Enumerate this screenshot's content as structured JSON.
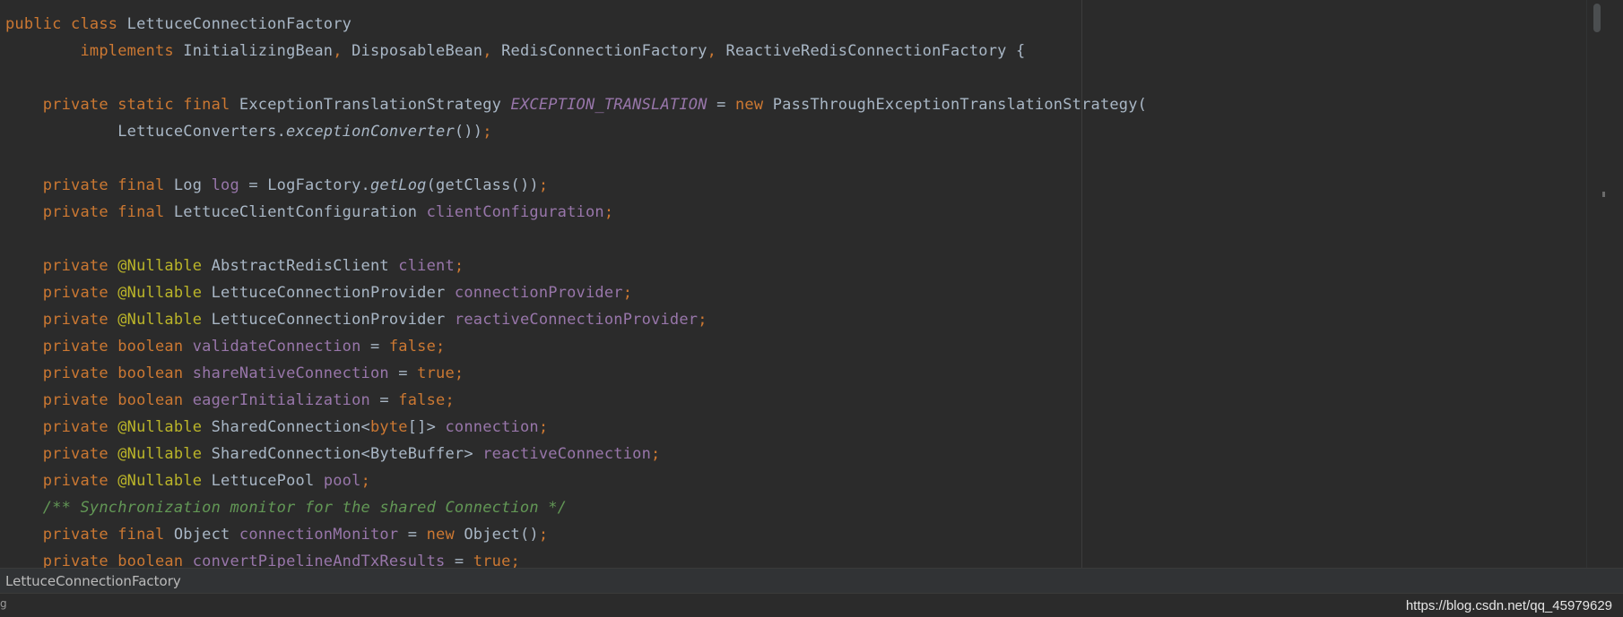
{
  "editor": {
    "lines": [
      [
        {
          "t": "public ",
          "c": "kw"
        },
        {
          "t": "class ",
          "c": "kw"
        },
        {
          "t": "LettuceConnectionFactory",
          "c": "id"
        }
      ],
      [
        {
          "t": "        ",
          "c": "id"
        },
        {
          "t": "implements ",
          "c": "kw"
        },
        {
          "t": "InitializingBean",
          "c": "id"
        },
        {
          "t": ", ",
          "c": "kw"
        },
        {
          "t": "DisposableBean",
          "c": "id"
        },
        {
          "t": ", ",
          "c": "kw"
        },
        {
          "t": "RedisConnectionFactory",
          "c": "id"
        },
        {
          "t": ", ",
          "c": "kw"
        },
        {
          "t": "ReactiveRedisConnectionFactory {",
          "c": "id"
        }
      ],
      [],
      [
        {
          "t": "    ",
          "c": "id"
        },
        {
          "t": "private static final ",
          "c": "kw"
        },
        {
          "t": "ExceptionTranslationStrategy ",
          "c": "id"
        },
        {
          "t": "EXCEPTION_TRANSLATION",
          "c": "sfld"
        },
        {
          "t": " = ",
          "c": "id"
        },
        {
          "t": "new ",
          "c": "kw"
        },
        {
          "t": "PassThroughExceptionTranslationStrategy(",
          "c": "id"
        }
      ],
      [
        {
          "t": "            LettuceConverters.",
          "c": "id"
        },
        {
          "t": "exceptionConverter",
          "c": "smeth"
        },
        {
          "t": "())",
          "c": "id"
        },
        {
          "t": ";",
          "c": "kw"
        }
      ],
      [],
      [
        {
          "t": "    ",
          "c": "id"
        },
        {
          "t": "private final ",
          "c": "kw"
        },
        {
          "t": "Log ",
          "c": "id"
        },
        {
          "t": "log",
          "c": "fld"
        },
        {
          "t": " = LogFactory.",
          "c": "id"
        },
        {
          "t": "getLog",
          "c": "smeth"
        },
        {
          "t": "(getClass())",
          "c": "id"
        },
        {
          "t": ";",
          "c": "kw"
        }
      ],
      [
        {
          "t": "    ",
          "c": "id"
        },
        {
          "t": "private final ",
          "c": "kw"
        },
        {
          "t": "LettuceClientConfiguration ",
          "c": "id"
        },
        {
          "t": "clientConfiguration",
          "c": "fld"
        },
        {
          "t": ";",
          "c": "kw"
        }
      ],
      [],
      [
        {
          "t": "    ",
          "c": "id"
        },
        {
          "t": "private ",
          "c": "kw"
        },
        {
          "t": "@Nullable ",
          "c": "ann"
        },
        {
          "t": "AbstractRedisClient ",
          "c": "id"
        },
        {
          "t": "client",
          "c": "fld"
        },
        {
          "t": ";",
          "c": "kw"
        }
      ],
      [
        {
          "t": "    ",
          "c": "id"
        },
        {
          "t": "private ",
          "c": "kw"
        },
        {
          "t": "@Nullable ",
          "c": "ann"
        },
        {
          "t": "LettuceConnectionProvider ",
          "c": "id"
        },
        {
          "t": "connectionProvider",
          "c": "fld"
        },
        {
          "t": ";",
          "c": "kw"
        }
      ],
      [
        {
          "t": "    ",
          "c": "id"
        },
        {
          "t": "private ",
          "c": "kw"
        },
        {
          "t": "@Nullable ",
          "c": "ann"
        },
        {
          "t": "LettuceConnectionProvider ",
          "c": "id"
        },
        {
          "t": "reactiveConnectionProvider",
          "c": "fld"
        },
        {
          "t": ";",
          "c": "kw"
        }
      ],
      [
        {
          "t": "    ",
          "c": "id"
        },
        {
          "t": "private boolean ",
          "c": "kw"
        },
        {
          "t": "validateConnection",
          "c": "fld"
        },
        {
          "t": " = ",
          "c": "id"
        },
        {
          "t": "false;",
          "c": "kw"
        }
      ],
      [
        {
          "t": "    ",
          "c": "id"
        },
        {
          "t": "private boolean ",
          "c": "kw"
        },
        {
          "t": "shareNativeConnection",
          "c": "fld"
        },
        {
          "t": " = ",
          "c": "id"
        },
        {
          "t": "true;",
          "c": "kw"
        }
      ],
      [
        {
          "t": "    ",
          "c": "id"
        },
        {
          "t": "private boolean ",
          "c": "kw"
        },
        {
          "t": "eagerInitialization",
          "c": "fld"
        },
        {
          "t": " = ",
          "c": "id"
        },
        {
          "t": "false;",
          "c": "kw"
        }
      ],
      [
        {
          "t": "    ",
          "c": "id"
        },
        {
          "t": "private ",
          "c": "kw"
        },
        {
          "t": "@Nullable ",
          "c": "ann"
        },
        {
          "t": "SharedConnection<",
          "c": "id"
        },
        {
          "t": "byte",
          "c": "kw"
        },
        {
          "t": "[]> ",
          "c": "id"
        },
        {
          "t": "connection",
          "c": "fld"
        },
        {
          "t": ";",
          "c": "kw"
        }
      ],
      [
        {
          "t": "    ",
          "c": "id"
        },
        {
          "t": "private ",
          "c": "kw"
        },
        {
          "t": "@Nullable ",
          "c": "ann"
        },
        {
          "t": "SharedConnection<ByteBuffer> ",
          "c": "id"
        },
        {
          "t": "reactiveConnection",
          "c": "fld"
        },
        {
          "t": ";",
          "c": "kw"
        }
      ],
      [
        {
          "t": "    ",
          "c": "id"
        },
        {
          "t": "private ",
          "c": "kw"
        },
        {
          "t": "@Nullable ",
          "c": "ann"
        },
        {
          "t": "LettucePool ",
          "c": "id"
        },
        {
          "t": "pool",
          "c": "fld"
        },
        {
          "t": ";",
          "c": "kw"
        }
      ],
      [
        {
          "t": "    ",
          "c": "id"
        },
        {
          "t": "/** Synchronization monitor for the shared Connection */",
          "c": "cmt"
        }
      ],
      [
        {
          "t": "    ",
          "c": "id"
        },
        {
          "t": "private final ",
          "c": "kw"
        },
        {
          "t": "Object ",
          "c": "id"
        },
        {
          "t": "connectionMonitor",
          "c": "fld"
        },
        {
          "t": " = ",
          "c": "id"
        },
        {
          "t": "new ",
          "c": "kw"
        },
        {
          "t": "Object()",
          "c": "id"
        },
        {
          "t": ";",
          "c": "kw"
        }
      ],
      [
        {
          "t": "    ",
          "c": "id"
        },
        {
          "t": "private boolean ",
          "c": "kw"
        },
        {
          "t": "convertPipelineAndTxResults",
          "c": "fld"
        },
        {
          "t": " = ",
          "c": "id"
        },
        {
          "t": "true;",
          "c": "kw"
        }
      ]
    ]
  },
  "breadcrumb": {
    "text": "LettuceConnectionFactory"
  },
  "status": {
    "left_fragment": "g",
    "watermark": "https://blog.csdn.net/qq_45979629"
  },
  "colors": {
    "background": "#2b2b2b",
    "keyword": "#cc7832",
    "identifier": "#a9b7c6",
    "field": "#9876aa",
    "annotation": "#bbb529",
    "comment": "#629755"
  },
  "icons": [
    "gear-icon",
    "menu-icon"
  ]
}
